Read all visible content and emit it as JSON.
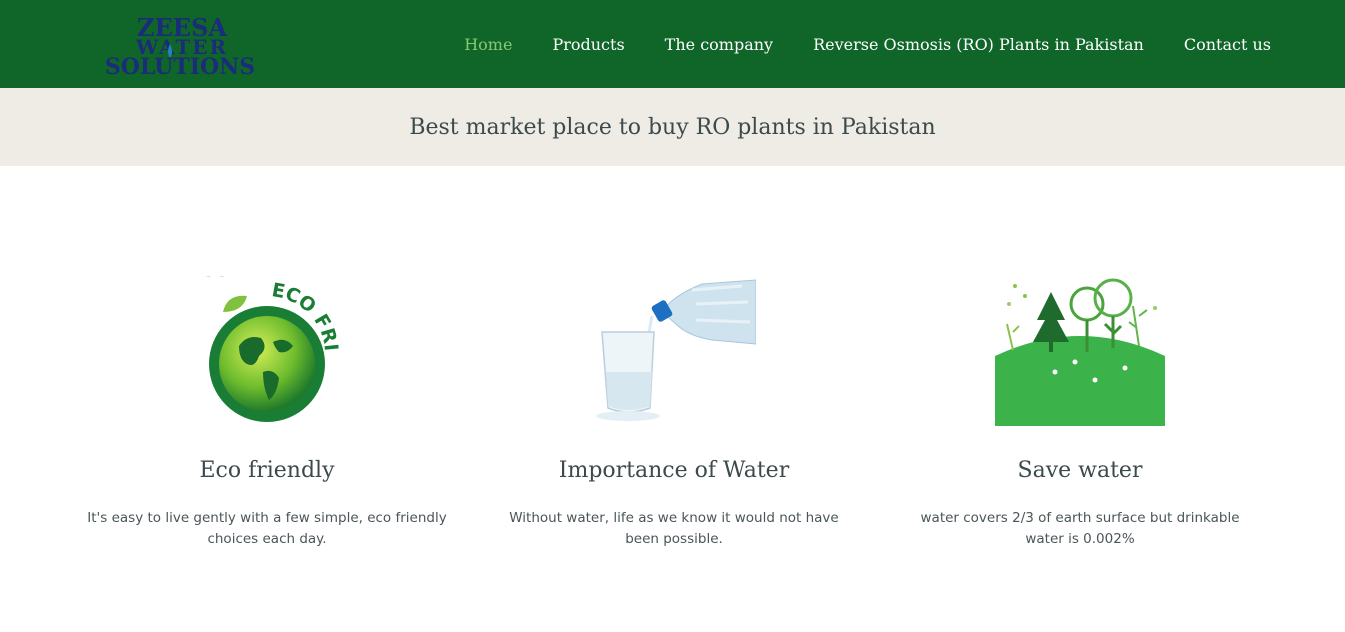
{
  "brand": {
    "logo_line1": "ZEESA",
    "logo_line2": "WATER",
    "logo_line3": "SOLUTIONS",
    "logo_color": "#1b2c7a"
  },
  "colors": {
    "nav_bg": "#106629",
    "nav_active": "#86c873",
    "banner_bg": "#efece5",
    "text_dark": "#3c4a4d"
  },
  "nav": {
    "items": [
      {
        "label": "Home",
        "active": true
      },
      {
        "label": "Products",
        "active": false
      },
      {
        "label": "The company",
        "active": false
      },
      {
        "label": "Reverse Osmosis (RO) Plants in Pakistan",
        "active": false
      },
      {
        "label": "Contact us",
        "active": false
      }
    ]
  },
  "banner": {
    "title": "Best market place to buy RO plants in Pakistan"
  },
  "features": [
    {
      "icon": "eco-friendly-globe-icon",
      "badge_text": "ECO FRIENDLY",
      "title": "Eco friendly",
      "text": "It's easy to live gently with a few simple, eco friendly choices each day."
    },
    {
      "icon": "water-bottle-pouring-icon",
      "title": "Importance of Water",
      "text": "Without water, life as we know it would not have been possible."
    },
    {
      "icon": "green-hill-trees-icon",
      "title": "Save water",
      "text": "water covers 2/3 of earth surface but drinkable water is 0.002%"
    }
  ]
}
